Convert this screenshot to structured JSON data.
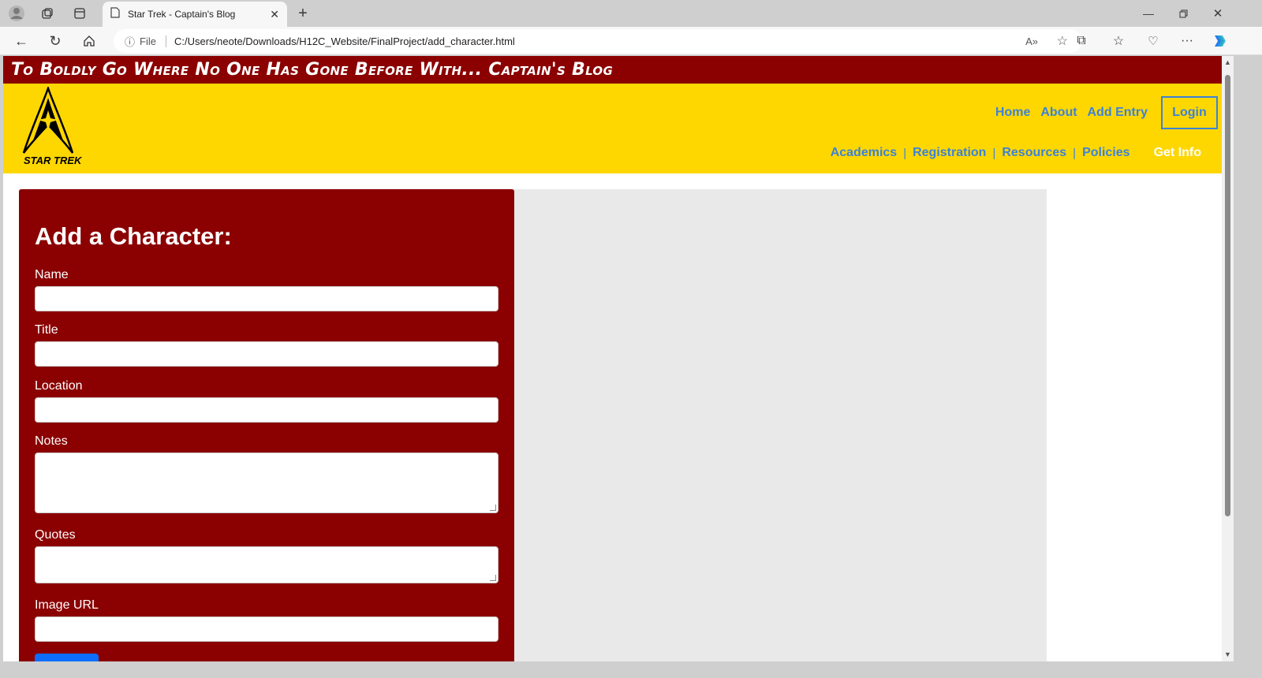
{
  "browser": {
    "tab_title": "Star Trek - Captain's Blog",
    "url_scheme": "File",
    "url": "C:/Users/neote/Downloads/H12C_Website/FinalProject/add_character.html"
  },
  "page": {
    "banner": "To Boldly Go Where No One Has Gone Before With... Captain's Blog",
    "logo_text": "STAR TREK",
    "nav_top": [
      "Home",
      "About",
      "Add Entry"
    ],
    "login_label": "Login",
    "nav_bottom": [
      "Academics",
      "Registration",
      "Resources",
      "Policies"
    ],
    "get_info": "Get Info"
  },
  "form": {
    "title": "Add a Character:",
    "fields": [
      {
        "label": "Name",
        "value": ""
      },
      {
        "label": "Title",
        "value": ""
      },
      {
        "label": "Location",
        "value": ""
      },
      {
        "label": "Notes",
        "value": ""
      },
      {
        "label": "Quotes",
        "value": ""
      },
      {
        "label": "Image URL",
        "value": ""
      }
    ]
  },
  "colors": {
    "banner": "#8b0000",
    "header": "#ffd700",
    "link": "#3c82d8",
    "submit": "#0d6efd"
  }
}
